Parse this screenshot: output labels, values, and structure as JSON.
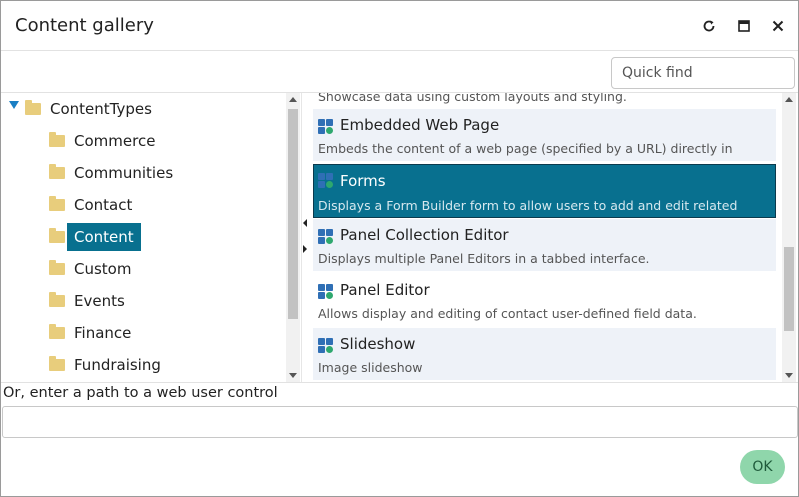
{
  "dialog": {
    "title": "Content gallery",
    "buttons": {
      "refresh_icon": "refresh-icon",
      "maximize_icon": "maximize-icon",
      "close_icon": "close-icon"
    }
  },
  "search": {
    "placeholder": "Quick find",
    "value": ""
  },
  "tree": {
    "root": "ContentTypes",
    "items": [
      {
        "label": "Commerce",
        "selected": false
      },
      {
        "label": "Communities",
        "selected": false
      },
      {
        "label": "Contact",
        "selected": false
      },
      {
        "label": "Content",
        "selected": true
      },
      {
        "label": "Custom",
        "selected": false
      },
      {
        "label": "Events",
        "selected": false
      },
      {
        "label": "Finance",
        "selected": false
      },
      {
        "label": "Fundraising",
        "selected": false
      }
    ]
  },
  "list": {
    "partial_top_desc": "Showcase data using custom layouts and styling.",
    "items": [
      {
        "title": "Embedded Web Page",
        "desc": "Embeds the content of a web page (specified by a URL) directly in",
        "selected": false
      },
      {
        "title": "Forms",
        "desc": "Displays a Form Builder form to allow users to add and edit related",
        "selected": true
      },
      {
        "title": "Panel Collection Editor",
        "desc": "Displays multiple Panel Editors in a tabbed interface.",
        "selected": false
      },
      {
        "title": "Panel Editor",
        "desc": "Allows display and editing of contact user-defined field data.",
        "selected": false
      },
      {
        "title": "Slideshow",
        "desc": "Image slideshow",
        "selected": false
      }
    ]
  },
  "footer": {
    "path_label": "Or, enter a path to a web user control",
    "path_value": "",
    "ok_label": "OK"
  },
  "colors": {
    "selection": "#08708f",
    "ok_button": "#8fd6ab",
    "folder": "#e8cd7c",
    "expander": "#1a7fc4"
  }
}
